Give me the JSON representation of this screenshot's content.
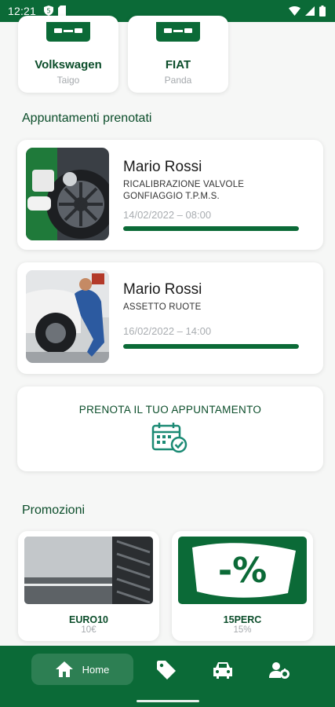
{
  "status_bar": {
    "time": "12:21"
  },
  "vehicles": [
    {
      "make": "Volkswagen",
      "model": "Taigo"
    },
    {
      "make": "FIAT",
      "model": "Panda"
    }
  ],
  "appointments_section": {
    "title": "Appuntamenti prenotati"
  },
  "appointments": [
    {
      "name": "Mario Rossi",
      "service": "RICALIBRAZIONE VALVOLE GONFIAGGIO T.P.M.S.",
      "datetime": "14/02/2022 – 08:00",
      "progress": 1.0
    },
    {
      "name": "Mario Rossi",
      "service": "ASSETTO RUOTE",
      "datetime": "16/02/2022 – 14:00",
      "progress": 1.0
    }
  ],
  "booking": {
    "label": "PRENOTA IL TUO APPUNTAMENTO",
    "icon": "calendar-check-icon"
  },
  "promotions_section": {
    "title": "Promozioni"
  },
  "promotions": [
    {
      "code": "EURO10",
      "value": "10€",
      "image": "winter-tyre-photo"
    },
    {
      "code": "15PERC",
      "value": "15%",
      "image": "percent-tag-graphic"
    }
  ],
  "bottom_nav": {
    "home_label": "Home",
    "items": [
      "home-icon",
      "tag-icon",
      "car-icon",
      "user-settings-icon"
    ]
  },
  "colors": {
    "primary": "#0b6a37",
    "title": "#0b4d2a",
    "muted": "#a5a9ad"
  }
}
